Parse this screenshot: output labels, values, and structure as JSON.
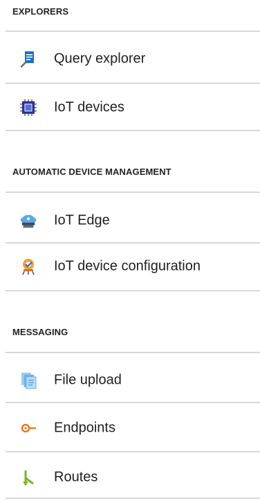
{
  "sections": [
    {
      "header": "EXPLORERS",
      "items": [
        {
          "label": "Query explorer",
          "icon": "query-explorer-icon"
        },
        {
          "label": "IoT devices",
          "icon": "chip-icon"
        }
      ]
    },
    {
      "header": "AUTOMATIC DEVICE MANAGEMENT",
      "items": [
        {
          "label": "IoT Edge",
          "icon": "cloud-edge-icon"
        },
        {
          "label": "IoT device configuration",
          "icon": "device-configuration-icon"
        }
      ]
    },
    {
      "header": "MESSAGING",
      "items": [
        {
          "label": "File upload",
          "icon": "file-upload-icon"
        },
        {
          "label": "Endpoints",
          "icon": "endpoint-icon"
        },
        {
          "label": "Routes",
          "icon": "route-icon"
        }
      ]
    }
  ]
}
